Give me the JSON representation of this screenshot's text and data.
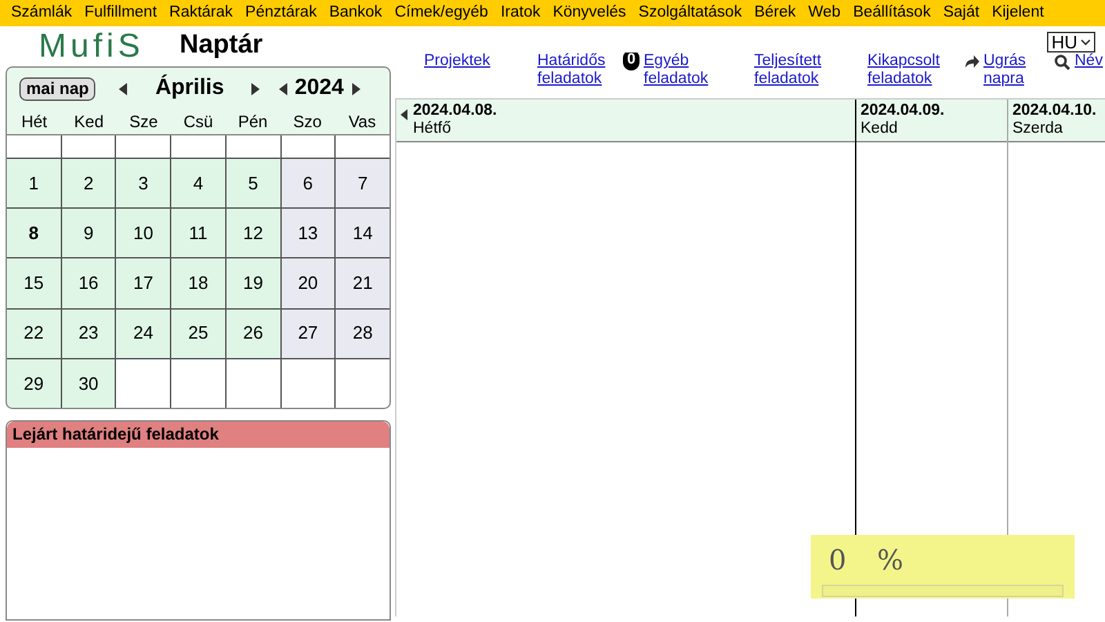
{
  "menu": [
    "Számlák",
    "Fulfillment",
    "Raktárak",
    "Pénztárak",
    "Bankok",
    "Címek/egyéb",
    "Iratok",
    "Könyvelés",
    "Szolgáltatások",
    "Bérek",
    "Web",
    "Beállítások",
    "Saját",
    "Kijelent"
  ],
  "logo": "MufiS",
  "page_title": "Naptár",
  "language": "HU",
  "calendar": {
    "today_button": "mai nap",
    "month": "Április",
    "year": "2024",
    "weekdays": [
      "Hét",
      "Ked",
      "Sze",
      "Csü",
      "Pén",
      "Szo",
      "Vas"
    ],
    "weeks": [
      [
        {
          "kind": "empty"
        },
        {
          "kind": "empty"
        },
        {
          "kind": "empty"
        },
        {
          "kind": "empty"
        },
        {
          "kind": "empty"
        },
        {
          "kind": "empty"
        },
        {
          "kind": "empty"
        }
      ],
      [
        {
          "day": "1",
          "weekend": false,
          "selected": false
        },
        {
          "day": "2",
          "weekend": false,
          "selected": false
        },
        {
          "day": "3",
          "weekend": false,
          "selected": false
        },
        {
          "day": "4",
          "weekend": false,
          "selected": false
        },
        {
          "day": "5",
          "weekend": false,
          "selected": false
        },
        {
          "day": "6",
          "weekend": true,
          "selected": false
        },
        {
          "day": "7",
          "weekend": true,
          "selected": false
        }
      ],
      [
        {
          "day": "8",
          "weekend": false,
          "selected": true
        },
        {
          "day": "9",
          "weekend": false,
          "selected": false
        },
        {
          "day": "10",
          "weekend": false,
          "selected": false
        },
        {
          "day": "11",
          "weekend": false,
          "selected": false
        },
        {
          "day": "12",
          "weekend": false,
          "selected": false
        },
        {
          "day": "13",
          "weekend": true,
          "selected": false
        },
        {
          "day": "14",
          "weekend": true,
          "selected": false
        }
      ],
      [
        {
          "day": "15",
          "weekend": false,
          "selected": false
        },
        {
          "day": "16",
          "weekend": false,
          "selected": false
        },
        {
          "day": "17",
          "weekend": false,
          "selected": false
        },
        {
          "day": "18",
          "weekend": false,
          "selected": false
        },
        {
          "day": "19",
          "weekend": false,
          "selected": false
        },
        {
          "day": "20",
          "weekend": true,
          "selected": false
        },
        {
          "day": "21",
          "weekend": true,
          "selected": false
        }
      ],
      [
        {
          "day": "22",
          "weekend": false,
          "selected": false
        },
        {
          "day": "23",
          "weekend": false,
          "selected": false
        },
        {
          "day": "24",
          "weekend": false,
          "selected": false
        },
        {
          "day": "25",
          "weekend": false,
          "selected": false
        },
        {
          "day": "26",
          "weekend": false,
          "selected": false
        },
        {
          "day": "27",
          "weekend": true,
          "selected": false
        },
        {
          "day": "28",
          "weekend": true,
          "selected": false
        }
      ],
      [
        {
          "day": "29",
          "weekend": false,
          "selected": false
        },
        {
          "day": "30",
          "weekend": false,
          "selected": false
        },
        {
          "kind": "empty"
        },
        {
          "kind": "empty"
        },
        {
          "kind": "empty"
        },
        {
          "kind": "empty"
        },
        {
          "kind": "empty"
        }
      ]
    ]
  },
  "overdue_panel": {
    "title": "Lejárt határidejű feladatok"
  },
  "toolbar": [
    {
      "kind": "link",
      "lines": [
        "Projektek"
      ]
    },
    {
      "kind": "link",
      "lines": [
        "Határidős",
        "feladatok"
      ]
    },
    {
      "kind": "count",
      "count": "0",
      "lines": [
        "Egyéb",
        "feladatok"
      ]
    },
    {
      "kind": "link",
      "lines": [
        "Teljesített",
        "feladatok"
      ]
    },
    {
      "kind": "link",
      "lines": [
        "Kikapcsolt",
        "feladatok"
      ]
    },
    {
      "kind": "jump",
      "lines": [
        "Ugrás",
        "napra"
      ]
    },
    {
      "kind": "search",
      "lines": [
        "Név"
      ]
    }
  ],
  "days": [
    {
      "date": "2024.04.08.",
      "weekday": "Hétfő"
    },
    {
      "date": "2024.04.09.",
      "weekday": "Kedd"
    },
    {
      "date": "2024.04.10.",
      "weekday": "Szerda"
    }
  ],
  "progress": {
    "value": "0",
    "unit": "%",
    "level": 0
  }
}
